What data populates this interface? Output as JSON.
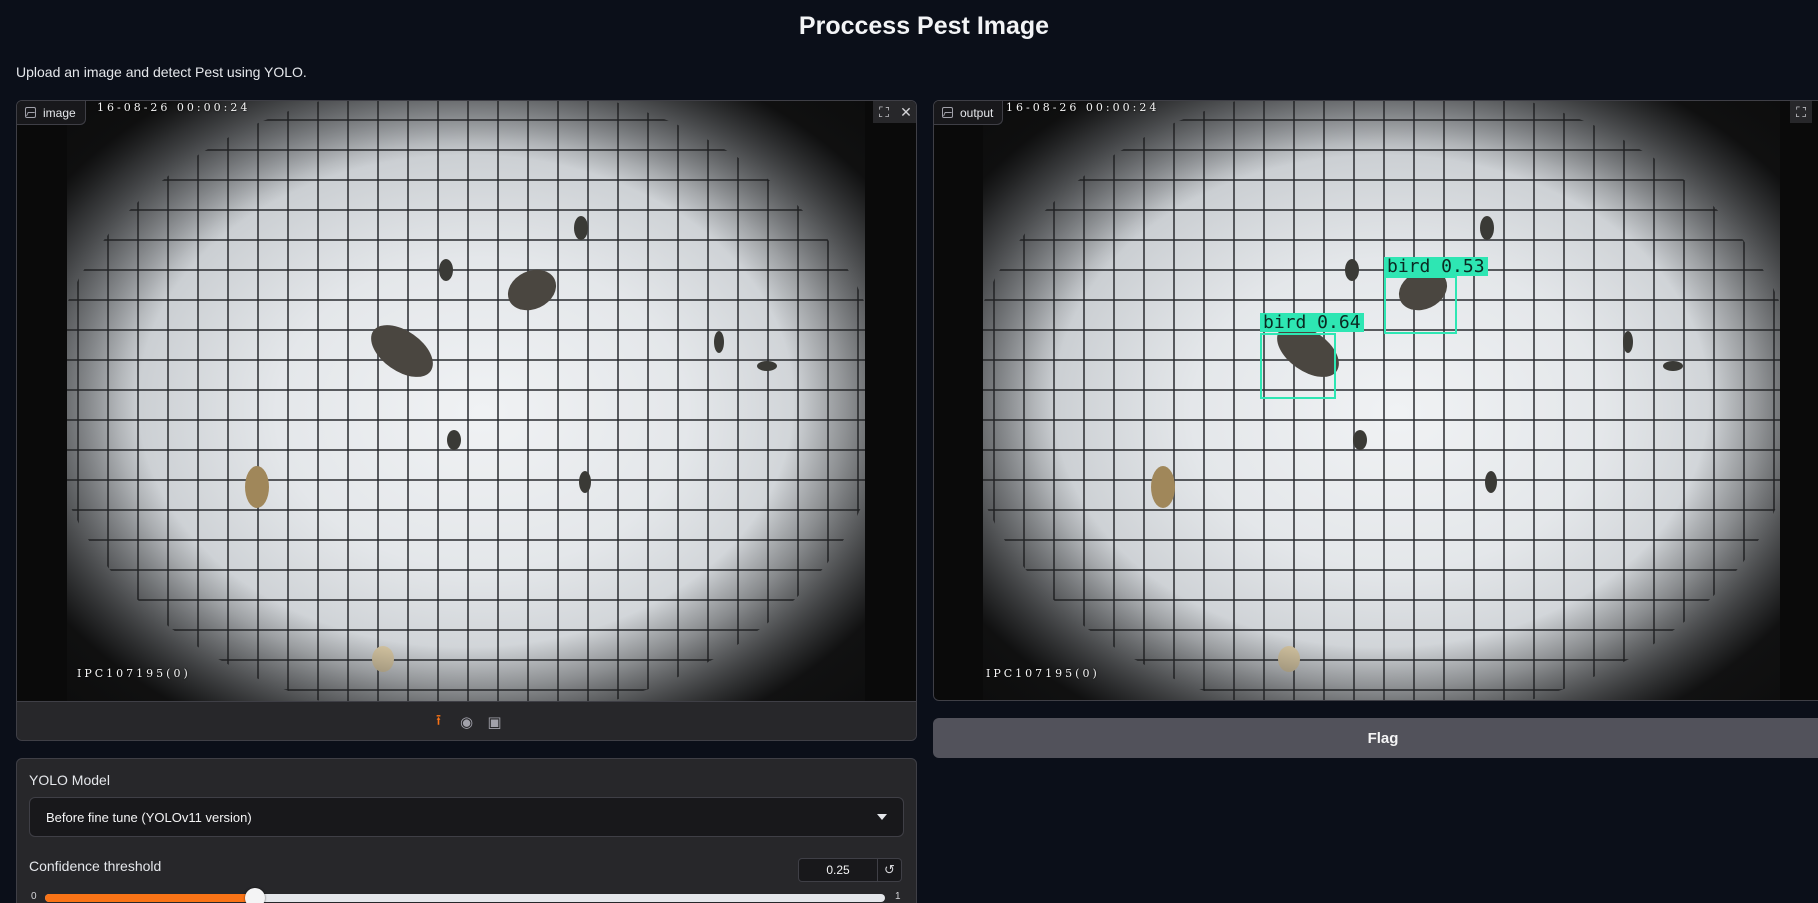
{
  "page": {
    "title": "Proccess Pest Image",
    "subtitle": "Upload an image and detect Pest using YOLO."
  },
  "input_panel": {
    "label": "image",
    "stamp_top": "16-08-26 00:00:24",
    "stamp_bottom": "IPC107195(0)",
    "upload_icons": [
      "upload-icon",
      "webcam-icon",
      "clipboard-icon"
    ]
  },
  "output_panel": {
    "label": "output",
    "stamp_top": "16-08-26 00:00:24",
    "stamp_bottom": "IPC107195(0)",
    "detections": [
      {
        "label": "bird 0.64"
      },
      {
        "label": "bird 0.53"
      }
    ]
  },
  "flag_button": {
    "label": "Flag"
  },
  "settings": {
    "model_label": "YOLO Model",
    "model_value": "Before fine tune (YOLOv11 version)",
    "confidence_label": "Confidence threshold",
    "confidence_value": "0.25",
    "slider_min": "0",
    "slider_max": "1",
    "slider_fraction": 0.25
  },
  "colors": {
    "accent": "#f97316",
    "detection_box": "#2ee6b3",
    "background": "#0b0f19"
  }
}
